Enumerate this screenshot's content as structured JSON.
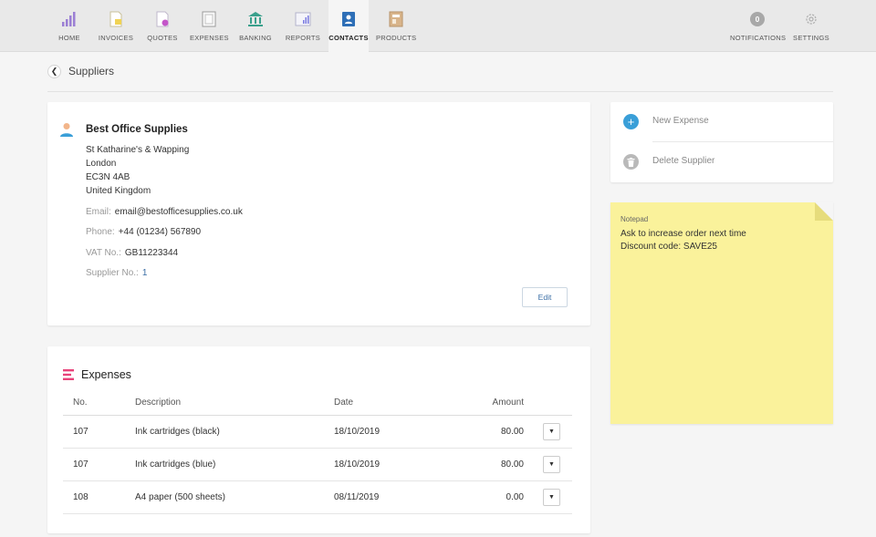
{
  "nav": {
    "items": [
      {
        "label": "HOME",
        "icon": "bar-chart-icon"
      },
      {
        "label": "INVOICES",
        "icon": "invoice-icon"
      },
      {
        "label": "QUOTES",
        "icon": "quote-icon"
      },
      {
        "label": "EXPENSES",
        "icon": "expense-icon"
      },
      {
        "label": "BANKING",
        "icon": "bank-icon"
      },
      {
        "label": "REPORTS",
        "icon": "report-icon"
      },
      {
        "label": "CONTACTS",
        "icon": "contacts-icon"
      },
      {
        "label": "PRODUCTS",
        "icon": "products-icon"
      }
    ],
    "active": "CONTACTS",
    "notifications": {
      "label": "NOTIFICATIONS",
      "count": "0"
    },
    "settings": {
      "label": "SETTINGS"
    }
  },
  "breadcrumb": {
    "title": "Suppliers"
  },
  "supplier": {
    "name": "Best Office Supplies",
    "address": [
      "St Katharine's & Wapping",
      "London",
      "EC3N 4AB",
      "United Kingdom"
    ],
    "email_label": "Email:",
    "email": "email@bestofficesupplies.co.uk",
    "phone_label": "Phone:",
    "phone": "+44 (01234) 567890",
    "vat_label": "VAT No.:",
    "vat": "GB11223344",
    "supplier_no_label": "Supplier No.:",
    "supplier_no": "1",
    "edit_label": "Edit"
  },
  "expenses": {
    "title": "Expenses",
    "columns": {
      "no": "No.",
      "description": "Description",
      "date": "Date",
      "amount": "Amount"
    },
    "rows": [
      {
        "no": "107",
        "description": "Ink cartridges (black)",
        "date": "18/10/2019",
        "amount": "80.00"
      },
      {
        "no": "107",
        "description": "Ink cartridges (blue)",
        "date": "18/10/2019",
        "amount": "80.00"
      },
      {
        "no": "108",
        "description": "A4 paper (500 sheets)",
        "date": "08/11/2019",
        "amount": "0.00"
      }
    ]
  },
  "actions": {
    "new_expense": "New Expense",
    "delete_supplier": "Delete Supplier"
  },
  "notepad": {
    "label": "Notepad",
    "lines": [
      "Ask to increase order next time",
      "Discount code: SAVE25"
    ]
  },
  "colors": {
    "accent_blue": "#3a9fd8",
    "link_blue": "#3a6ea5",
    "notepad_yellow": "#faf29b",
    "expenses_pink": "#e8437a"
  }
}
